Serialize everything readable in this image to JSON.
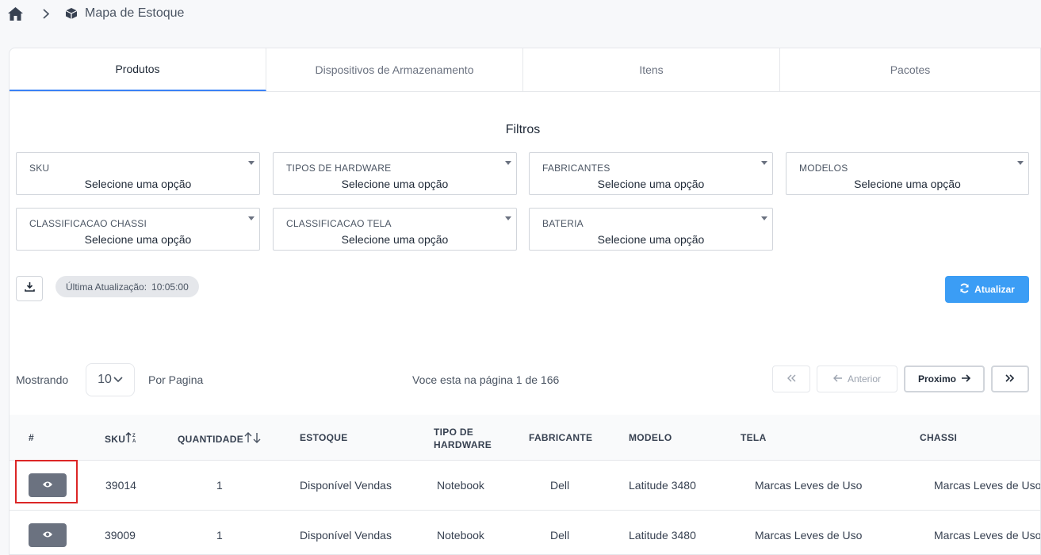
{
  "breadcrumb": {
    "home_icon": "home-icon",
    "separator_icon": "chevron-right-icon",
    "page_icon": "cube-icon",
    "label": "Mapa de Estoque"
  },
  "tabs": [
    {
      "label": "Produtos",
      "active": true
    },
    {
      "label": "Dispositivos de Armazenamento",
      "active": false
    },
    {
      "label": "Itens",
      "active": false
    },
    {
      "label": "Pacotes",
      "active": false
    }
  ],
  "filters": {
    "title": "Filtros",
    "fields": [
      {
        "label": "SKU",
        "value": "Selecione uma opção"
      },
      {
        "label": "TIPOS DE HARDWARE",
        "value": "Selecione uma opção"
      },
      {
        "label": "FABRICANTES",
        "value": "Selecione uma opção"
      },
      {
        "label": "MODELOS",
        "value": "Selecione uma opção"
      },
      {
        "label": "CLASSIFICACAO CHASSI",
        "value": "Selecione uma opção"
      },
      {
        "label": "CLASSIFICACAO TELA",
        "value": "Selecione uma opção"
      },
      {
        "label": "BATERIA",
        "value": "Selecione uma opção"
      }
    ]
  },
  "toolbar": {
    "download_icon": "download-icon",
    "last_update_label": "Última Atualização:",
    "last_update_time": "10:05:00",
    "refresh_icon": "refresh-icon",
    "refresh_label": "Atualizar"
  },
  "pagination": {
    "showing_label": "Mostrando",
    "page_size": "10",
    "per_page_label": "Por Pagina",
    "page_info": "Voce esta na página 1 de 166",
    "prev_label": "Anterior",
    "next_label": "Proximo"
  },
  "table": {
    "columns": [
      "#",
      "SKU",
      "QUANTIDADE",
      "ESTOQUE",
      "TIPO DE",
      "HARDWARE",
      "FABRICANTE",
      "MODELO",
      "TELA",
      "CHASSI"
    ],
    "rows": [
      {
        "sku": "39014",
        "quantidade": "1",
        "estoque": "Disponível Vendas",
        "tipo": "Notebook",
        "fabricante": "Dell",
        "modelo": "Latitude 3480",
        "tela": "Marcas Leves de Uso",
        "chassi": "Marcas Leves de Uso"
      },
      {
        "sku": "39009",
        "quantidade": "1",
        "estoque": "Disponível Vendas",
        "tipo": "Notebook",
        "fabricante": "Dell",
        "modelo": "Latitude 3480",
        "tela": "Marcas Leves de Uso",
        "chassi": "Marcas Leves de Uso"
      }
    ]
  },
  "colors": {
    "accent": "#3b82f6",
    "refresh_button": "#3b9df5",
    "view_button": "#6b7280",
    "highlight": "#dc2626"
  }
}
